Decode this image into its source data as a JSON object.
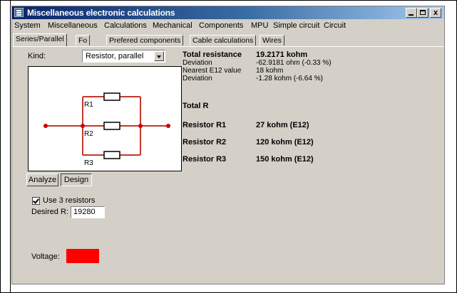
{
  "window": {
    "title": "Miscellaneous electronic calculations",
    "controls": {
      "minimize": "_",
      "maximize": "□",
      "close": "x"
    }
  },
  "menu": [
    "System",
    "Miscellaneous",
    "Calculations",
    "Mechanical",
    "Components",
    "MPU",
    "Simple circuit",
    "Circuit"
  ],
  "tabs": [
    "Series/Parallel",
    "Fo",
    "Prefered components",
    "Cable calculations",
    "Wires"
  ],
  "kind": {
    "label": "Kind:",
    "selected": "Resistor, parallel"
  },
  "circuit": {
    "labels": [
      "R1",
      "R2",
      "R3"
    ],
    "wire_color": "#c0392b",
    "node_color": "#cc0000"
  },
  "buttons": {
    "analyze": "Analyze",
    "design": "Design"
  },
  "use_resistors": {
    "label": "Use 3 resistors",
    "checked": true
  },
  "desired": {
    "label": "Desired R:",
    "value": "19280"
  },
  "voltage": {
    "label": "Voltage:",
    "color": "#ff0000"
  },
  "results": {
    "total_resistance_label": "Total resistance",
    "total_resistance_value": "19.2171 kohm",
    "deviation_label": "Deviation",
    "deviation_value": "-62.9181 ohm  (-0.33 %)",
    "nearest_label": "Nearest E12 value",
    "nearest_value": "18 kohm",
    "deviation2_label": "Deviation",
    "deviation2_value": "-1.28 kohm  (-6.64 %)",
    "total_r_label": "Total R",
    "r1_label": "Resistor R1",
    "r1_value": "27 kohm  (E12)",
    "r2_label": "Resistor R2",
    "r2_value": "120 kohm  (E12)",
    "r3_label": "Resistor R3",
    "r3_value": "150 kohm  (E12)"
  }
}
